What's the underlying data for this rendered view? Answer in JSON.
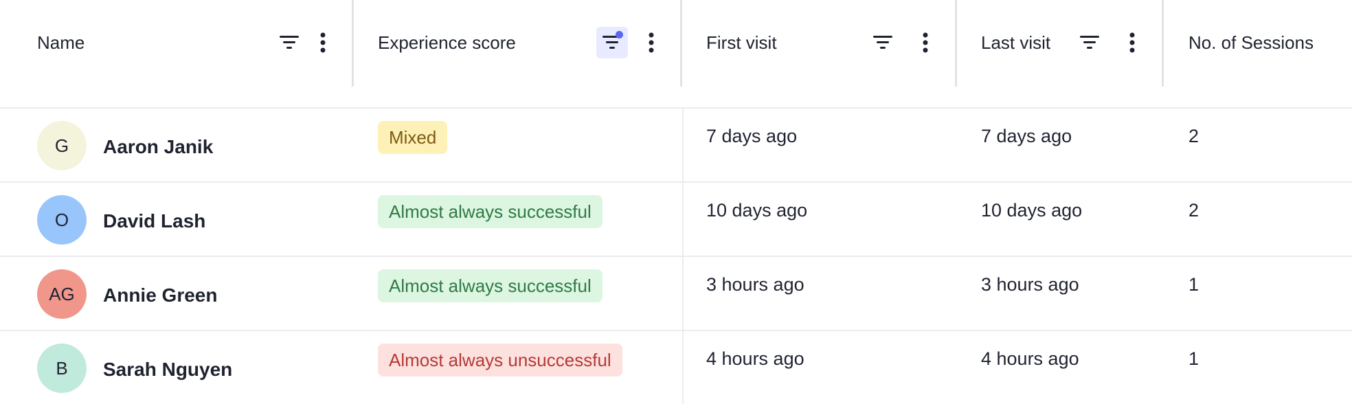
{
  "columns": [
    {
      "label": "Name",
      "filter_active": false
    },
    {
      "label": "Experience score",
      "filter_active": true
    },
    {
      "label": "First visit",
      "filter_active": false
    },
    {
      "label": "Last visit",
      "filter_active": false
    },
    {
      "label": "No. of Sessions"
    }
  ],
  "icons": {
    "filter": "filter-lines-icon",
    "more": "vertical-dots-icon"
  },
  "rows": [
    {
      "initials": "G",
      "avatar_color": "#f4f4dc",
      "name": "Aaron Janik",
      "experience": "Mixed",
      "experience_bg": "#fdf1b7",
      "experience_color": "#7d5a12",
      "first_visit": "7 days ago",
      "last_visit": "7 days ago",
      "sessions": "2"
    },
    {
      "initials": "O",
      "avatar_color": "#98c5fb",
      "name": "David Lash",
      "experience": "Almost always successful",
      "experience_bg": "#dcf6e1",
      "experience_color": "#2f7a45",
      "first_visit": "10 days ago",
      "last_visit": "10 days ago",
      "sessions": "2"
    },
    {
      "initials": "AG",
      "avatar_color": "#f0968a",
      "name": "Annie Green",
      "experience": "Almost always successful",
      "experience_bg": "#dcf6e1",
      "experience_color": "#2f7a45",
      "first_visit": "3 hours ago",
      "last_visit": "3 hours ago",
      "sessions": "1"
    },
    {
      "initials": "B",
      "avatar_color": "#c0eadb",
      "name": "Sarah Nguyen",
      "experience": "Almost always unsuccessful",
      "experience_bg": "#fce1df",
      "experience_color": "#b53a34",
      "first_visit": "4 hours ago",
      "last_visit": "4 hours ago",
      "sessions": "1"
    }
  ]
}
